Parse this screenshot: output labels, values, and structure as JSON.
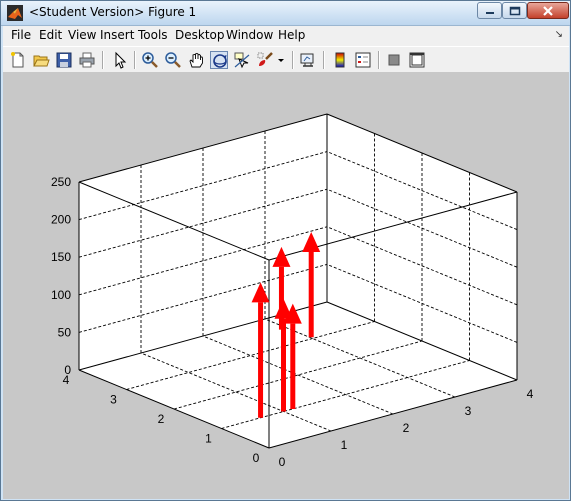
{
  "window": {
    "title": "<Student Version> Figure 1",
    "icon": "matlab-icon",
    "controls": [
      "minimize-icon",
      "maximize-icon",
      "close-icon"
    ]
  },
  "menu": {
    "items": [
      "File",
      "Edit",
      "View",
      "Insert",
      "Tools",
      "Desktop",
      "Window",
      "Help"
    ],
    "dock_icon": "dock-arrow-icon"
  },
  "toolbar": {
    "tools": [
      "new-figure-icon",
      "open-file-icon",
      "save-icon",
      "print-icon",
      "edit-plot-arrow-icon",
      "zoom-in-icon",
      "zoom-out-icon",
      "pan-hand-icon",
      "rotate-3d-icon",
      "data-cursor-icon",
      "brush-icon",
      "brush-dropdown-icon",
      "link-plot-icon",
      "insert-colorbar-icon",
      "insert-legend-icon",
      "hide-plot-tools-icon",
      "show-plot-tools-icon"
    ],
    "active_tool": "rotate-3d-icon"
  },
  "chart_data": {
    "type": "quiver3",
    "title": "",
    "xlabel": "",
    "ylabel": "",
    "zlabel": "",
    "xlim": [
      0,
      4
    ],
    "ylim": [
      0,
      4
    ],
    "zlim": [
      0,
      250
    ],
    "xticks": [
      "0",
      "1",
      "2",
      "3",
      "4"
    ],
    "yticks": [
      "0",
      "1",
      "2",
      "3",
      "4"
    ],
    "zticks": [
      "0",
      "50",
      "100",
      "150",
      "200",
      "250"
    ],
    "grid": true,
    "box": true,
    "arrow_color": "#ff0000",
    "arrows": [
      {
        "x": 0.63,
        "y": 1.0,
        "z": 0,
        "dz": 180
      },
      {
        "x": 1.0,
        "y": 1.0,
        "z": 0,
        "dz": 150
      },
      {
        "x": 1.15,
        "y": 1.0,
        "z": 0,
        "dz": 140
      },
      {
        "x": 1.6,
        "y": 1.2,
        "z": 80,
        "dz": 140
      },
      {
        "x": 1.58,
        "y": 1.8,
        "z": 75,
        "dz": 110
      }
    ]
  }
}
